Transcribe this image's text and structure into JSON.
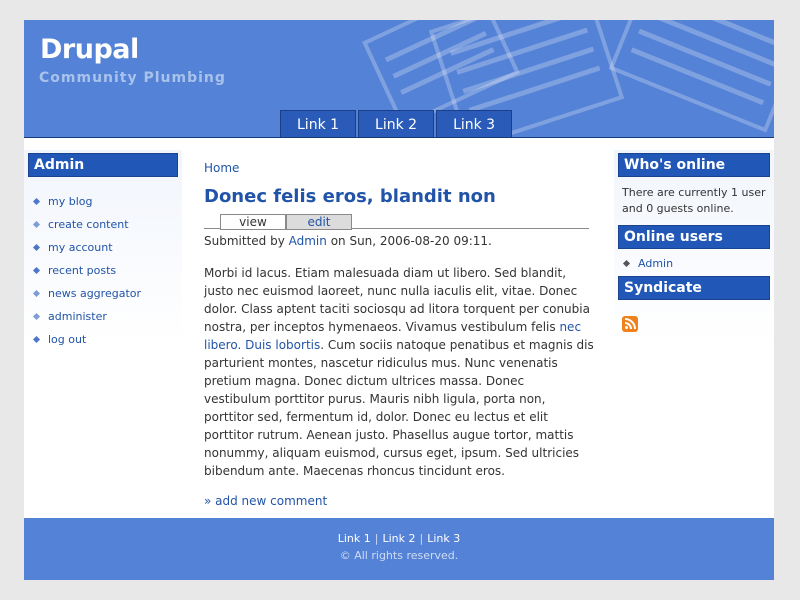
{
  "site": {
    "name": "Drupal",
    "slogan": "Community Plumbing",
    "primary_links": [
      "Link 1",
      "Link 2",
      "Link 3"
    ]
  },
  "sidebar_left": {
    "title": "Admin",
    "menu": [
      {
        "label": "my blog",
        "type": "collapsed"
      },
      {
        "label": "create content",
        "type": "leaf"
      },
      {
        "label": "my account",
        "type": "collapsed"
      },
      {
        "label": "recent posts",
        "type": "collapsed"
      },
      {
        "label": "news aggregator",
        "type": "leaf"
      },
      {
        "label": "administer",
        "type": "leaf"
      },
      {
        "label": "log out",
        "type": "collapsed"
      }
    ]
  },
  "main": {
    "breadcrumb": "Home",
    "title": "Donec felis eros, blandit non",
    "tabs": {
      "view": "view",
      "edit": "edit"
    },
    "submitted": {
      "prefix": "Submitted by ",
      "author": "Admin",
      "suffix": " on Sun, 2006-08-20 09:11."
    },
    "body": {
      "part1": "Morbi id lacus. Etiam malesuada diam ut libero. Sed blandit, justo nec euismod laoreet, nunc nulla iaculis elit, vitae. Donec dolor. Class aptent taciti sociosqu ad litora torquent per conubia nostra, per inceptos hymenaeos. Vivamus vestibulum felis ",
      "link1": "nec libero.",
      "link2": "Duis lobortis",
      "part2": ". Cum sociis natoque penatibus et magnis dis parturient montes, nascetur ridiculus mus. Nunc venenatis pretium magna. Donec dictum ultrices massa. Donec vestibulum porttitor purus. Mauris nibh ligula, porta non, porttitor sed, fermentum id, dolor. Donec eu lectus et elit porttitor rutrum. Aenean justo. Phasellus augue tortor, mattis nonummy, aliquam euismod, cursus eget, ipsum. Sed ultricies bibendum ante. Maecenas rhoncus tincidunt eros."
    },
    "add_comment": "» add new comment"
  },
  "sidebar_right": {
    "whos_online_title": "Who's online",
    "whos_online_text": "There are currently 1 user and 0 guests online.",
    "online_users_title": "Online users",
    "online_users": [
      "Admin"
    ],
    "syndicate_title": "Syndicate",
    "feed_icon": "rss-feed-icon"
  },
  "footer": {
    "links": [
      "Link 1",
      "Link 2",
      "Link 3"
    ],
    "separator": "|",
    "message": "© All rights reserved."
  },
  "colors": {
    "header_bg": "#5482d6",
    "block_title_bg": "#2158b7",
    "link": "#2154a8",
    "feed": "#f0821e"
  }
}
